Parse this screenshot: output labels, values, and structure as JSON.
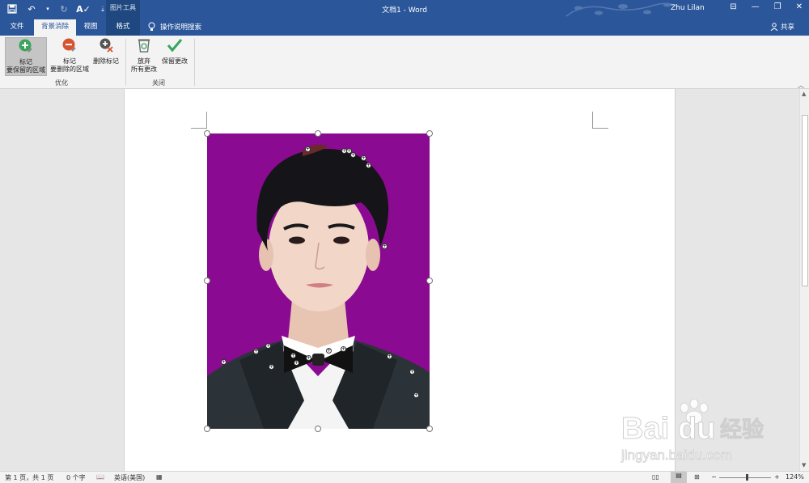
{
  "titlebar": {
    "context_tools": "图片工具",
    "doc_title": "文档1 - Word",
    "user": "Zhu Lilan"
  },
  "tabs": {
    "file": "文件",
    "background_removal": "背景消除",
    "view": "视图",
    "format": "格式",
    "tell_me": "操作说明搜索",
    "share": "共享"
  },
  "ribbon": {
    "mark_keep": "标记\n要保留的区域",
    "mark_keep_l1": "标记",
    "mark_keep_l2": "要保留的区域",
    "mark_remove_l1": "标记",
    "mark_remove_l2": "要删除的区域",
    "delete_mark": "删除标记",
    "discard_l1": "放弃",
    "discard_l2": "所有更改",
    "keep_changes": "保留更改",
    "group_refine": "优化",
    "group_close": "关闭"
  },
  "statusbar": {
    "page": "第 1 页，共 1 页",
    "words": "0 个字",
    "language": "英语(美国)",
    "zoom": "124%"
  },
  "watermark": {
    "brand": "Baidu经验",
    "url": "jingyan.baidu.com"
  },
  "colors": {
    "accent": "#2b579a",
    "photo_background": "#8a0a91",
    "ribbon": "#f3f3f3"
  }
}
